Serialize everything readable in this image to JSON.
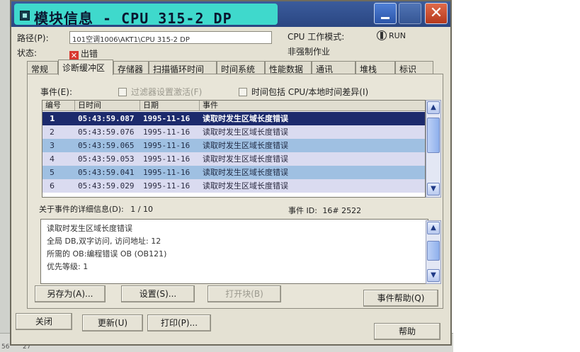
{
  "window": {
    "title": "模块信息 - CPU 315-2 DP",
    "close_glyph": "✕"
  },
  "header": {
    "path_label": "路径(P):",
    "path_value": "101空调1006\\AKT1\\CPU 315-2 DP",
    "status_label": "状态:",
    "status_value": "出错",
    "cpu_mode_label": "CPU 工作模式:",
    "cpu_mode_value": "RUN",
    "force_label": "非强制作业"
  },
  "tabs": [
    {
      "label": "常规"
    },
    {
      "label": "诊断缓冲区",
      "active": true
    },
    {
      "label": "存储器"
    },
    {
      "label": "扫描循环时间"
    },
    {
      "label": "时间系统"
    },
    {
      "label": "性能数据"
    },
    {
      "label": "通讯"
    },
    {
      "label": "堆栈"
    },
    {
      "label": "标识"
    }
  ],
  "events": {
    "label": "事件(E):",
    "filter_label": "过滤器设置激活(F)",
    "time_label": "时间包括 CPU/本地时间差异(I)"
  },
  "table": {
    "columns": [
      "编号",
      "日时间",
      "日期",
      "事件"
    ],
    "rows": [
      {
        "no": "1",
        "time": "05:43:59.087",
        "date": "1995-11-16",
        "event": "读取时发生区域长度错误"
      },
      {
        "no": "2",
        "time": "05:43:59.076",
        "date": "1995-11-16",
        "event": "读取时发生区域长度错误"
      },
      {
        "no": "3",
        "time": "05:43:59.065",
        "date": "1995-11-16",
        "event": "读取时发生区域长度错误"
      },
      {
        "no": "4",
        "time": "05:43:59.053",
        "date": "1995-11-16",
        "event": "读取时发生区域长度错误"
      },
      {
        "no": "5",
        "time": "05:43:59.041",
        "date": "1995-11-16",
        "event": "读取时发生区域长度错误"
      },
      {
        "no": "6",
        "time": "05:43:59.029",
        "date": "1995-11-16",
        "event": "读取时发生区域长度错误"
      }
    ]
  },
  "details": {
    "label": "关于事件的详细信息(D):",
    "position": "1 / 10",
    "event_id_label": "事件 ID:",
    "event_id_value": "16# 2522",
    "lines": [
      "读取时发生区域长度错误",
      "全局 DB,双字访问, 访问地址:       12",
      "所需的 OB:编程错误 OB (OB121)",
      "优先等级: 1"
    ]
  },
  "buttons": {
    "save_as": "另存为(A)...",
    "settings": "设置(S)...",
    "open_block": "打开块(B)",
    "event_help": "事件帮助(Q)",
    "close": "关闭",
    "update": "更新(U)",
    "print": "打印(P)...",
    "help": "帮助"
  },
  "background": {
    "status_left": "56",
    "status_right": "27"
  },
  "colors": {
    "title_accent": "#3fd9cc",
    "selected_row": "#1c2a6c",
    "dialog_bg": "#e4e1d3"
  }
}
